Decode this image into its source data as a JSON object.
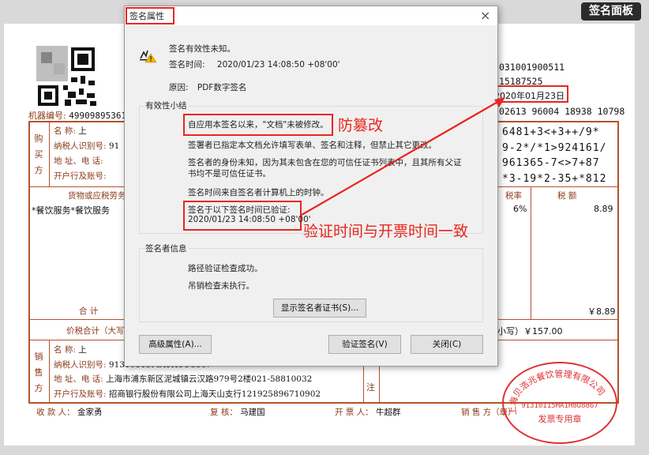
{
  "top": {
    "signature_panel_btn": "签名面板"
  },
  "invoice": {
    "code": "031001900511",
    "number": "15187525",
    "date": "2020年01月23日",
    "check_code": "02613 96004 18938 10798",
    "machine_no_label": "机器编号:",
    "machine_no": "49909895361",
    "buyer_label": [
      "购",
      "买",
      "方"
    ],
    "buyer_fields": {
      "name": "名    称:",
      "taxid": "纳税人识别号:",
      "addr": "地 址、电 话:",
      "bank": "开户行及账号:"
    },
    "buyer_name_partial": "上",
    "buyer_taxid_partial": "91",
    "cipher": [
      "6481+3<+3++/9*",
      "9-2*/*1>924161/",
      "961365-7<>7+87",
      "*3-19*2-35+*812"
    ],
    "goods_header": "货物或应税劳务、服",
    "goods_item": "*餐饮服务*餐饮服务",
    "tax_rate_header": "税率",
    "tax_amount_header": "税  额",
    "tax_rate": "6%",
    "tax_amount": "8.89",
    "total_label": "合      计",
    "total_tax": "￥8.89",
    "grand_total_label": "价税合计（大写）",
    "grand_total_small": "小写）￥157.00",
    "seller_label": [
      "销",
      "售",
      "方"
    ],
    "seller_name_partial": "上",
    "seller_taxid": "91310115MA1H8U8867",
    "seller_addr": "上海市浦东新区泥城镇云汉路979号2楼021-58810032",
    "seller_bank": "招商银行股份有限公司上海天山支行121925896710902",
    "remark_label": "注",
    "payee_label": "收 款 人：",
    "payee": "金家勇",
    "reviewer_label": "复  核：",
    "reviewer": "马建国",
    "drawer_label": "开 票 人：",
    "drawer": "牛超群",
    "seller_sign_label": "销  售  方（章）",
    "seal_company": "上海贝浩兆餐饮管理有限公司",
    "seal_taxid": "91310115MA1H8U8867",
    "seal_bottom": "发票专用章"
  },
  "dialog": {
    "title": "签名属性",
    "validity_unknown": "签名有效性未知。",
    "sign_time_label": "签名时间:",
    "sign_time": "2020/01/23 14:08:50 +08'00'",
    "reason_label": "原因:",
    "reason": "PDF数字签名",
    "summary_group": "有效性小结",
    "not_modified": "自应用本签名以来，\"文档\"未被修改。",
    "permissions": "签署者已指定本文档允许填写表单、签名和注释，但禁止其它更改。",
    "identity_unknown_1": "签名者的身份未知，因为其未包含在您的可信任证书列表中，且其所有父证",
    "identity_unknown_2": "书均不是可信任证书。",
    "time_from_computer": "签名时间来自签名者计算机上的时钟。",
    "verified_at_label": "签名于以下签名时间已验证:",
    "verified_at": "2020/01/23 14:08:50 +08'00'",
    "signer_group": "签名者信息",
    "path_ok": "路径验证检查成功。",
    "revocation": "吊销检查未执行。",
    "show_cert_btn": "显示签名者证书(S)...",
    "advanced_btn": "高级属性(A)...",
    "verify_btn": "验证签名(V)",
    "close_btn": "关闭(C)",
    "close_icon": "close-icon",
    "warning_icon": "signature-warning-icon"
  },
  "annotations": {
    "tamper_proof": "防篡改",
    "time_consistent": "验证时间与开票时间一致",
    "color": "#e8261f"
  }
}
